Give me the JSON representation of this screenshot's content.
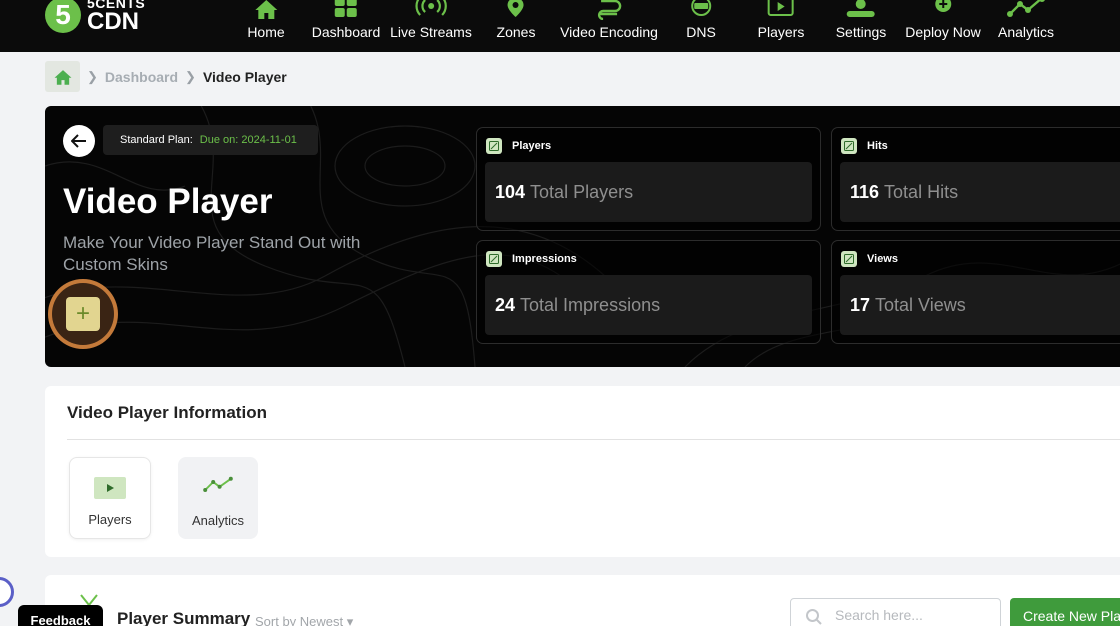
{
  "brand": {
    "badge": "5",
    "line1": "5CENTS",
    "line2": "CDN",
    "accent": "#6cc04a"
  },
  "nav": [
    {
      "label": "Home",
      "icon": "home-icon"
    },
    {
      "label": "Dashboard",
      "icon": "dashboard-icon"
    },
    {
      "label": "Live Streams",
      "icon": "live-streams-icon"
    },
    {
      "label": "Zones",
      "icon": "map-pin-icon"
    },
    {
      "label": "Video Encoding",
      "icon": "encoding-icon"
    },
    {
      "label": "DNS",
      "icon": "dns-icon"
    },
    {
      "label": "Players",
      "icon": "player-icon"
    },
    {
      "label": "Settings",
      "icon": "settings-icon"
    },
    {
      "label": "Deploy Now",
      "icon": "deploy-icon"
    },
    {
      "label": "Analytics",
      "icon": "analytics-icon"
    }
  ],
  "breadcrumb": {
    "parent": "Dashboard",
    "current": "Video Player"
  },
  "hero": {
    "plan_label": "Standard Plan:",
    "plan_due": "Due on: 2024-11-01",
    "title": "Video Player",
    "subtitle": "Make Your Video Player Stand Out with Custom Skins",
    "add_symbol": "+"
  },
  "stats": {
    "players": {
      "label": "Players",
      "value": "104",
      "suffix": "Total Players"
    },
    "hits": {
      "label": "Hits",
      "value": "116",
      "suffix": "Total Hits"
    },
    "impressions": {
      "label": "Impressions",
      "value": "24",
      "suffix": "Total Impressions"
    },
    "views": {
      "label": "Views",
      "value": "17",
      "suffix": "Total Views"
    }
  },
  "info": {
    "title": "Video Player Information",
    "tiles": [
      {
        "label": "Players",
        "icon": "player-icon"
      },
      {
        "label": "Analytics",
        "icon": "analytics-icon"
      }
    ]
  },
  "summary": {
    "title": "Player Summary",
    "sort_label": "Sort by Newest",
    "search_placeholder": "Search here...",
    "create_label": "Create New Player"
  },
  "feedback_label": "Feedback"
}
